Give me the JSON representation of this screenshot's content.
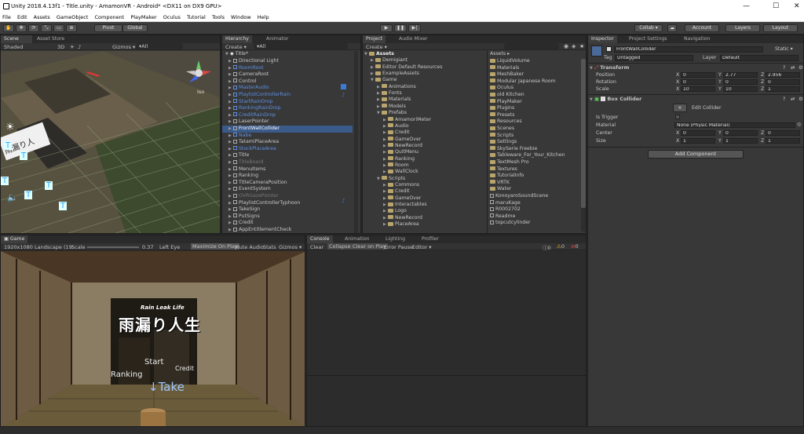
{
  "window": {
    "title": "Unity 2018.4.13f1 - Title.unity - AmamonVR - Android* <DX11 on DX9 GPU>"
  },
  "menu": [
    "File",
    "Edit",
    "Assets",
    "GameObject",
    "Component",
    "PlayMaker",
    "Oculus",
    "Tutorial",
    "Tools",
    "Window",
    "Help"
  ],
  "toolbar": {
    "pivot": "Pivot",
    "global": "Global",
    "collab": "Collab ▾",
    "account": "Account",
    "layers": "Layers",
    "layout": "Layout"
  },
  "scene": {
    "tabs": [
      "Scene",
      "Asset Store"
    ],
    "shading": "Shaded",
    "mode2d": "3D",
    "gizmos": "Gizmos ▾",
    "search": "▾All",
    "iso": "Iso"
  },
  "hierarchy": {
    "tabs": [
      "Hierarchy",
      "Animator"
    ],
    "create": "Create ▾",
    "search": "▾All",
    "scene_name": "Title*",
    "items": [
      {
        "label": "Directional Light",
        "style": "normal"
      },
      {
        "label": "RoomRoot",
        "style": "blue"
      },
      {
        "label": "CameraRoot",
        "style": "normal"
      },
      {
        "label": "Control",
        "style": "normal"
      },
      {
        "label": "MasterAudio",
        "style": "blue"
      },
      {
        "label": "PlaylistControllerRain",
        "style": "blue"
      },
      {
        "label": "StartRainDrop",
        "style": "blue"
      },
      {
        "label": "RankingRainDrop",
        "style": "blue"
      },
      {
        "label": "CreditRainDrop",
        "style": "blue"
      },
      {
        "label": "LaserPointer",
        "style": "normal"
      },
      {
        "label": "FrontWallCollider",
        "style": "selected"
      },
      {
        "label": "Nabe",
        "style": "blue"
      },
      {
        "label": "TatamiPlaceArea",
        "style": "normal"
      },
      {
        "label": "StockPlaceArea",
        "style": "blue"
      },
      {
        "label": "Title",
        "style": "normal"
      },
      {
        "label": "TitleBoard",
        "style": "grayed"
      },
      {
        "label": "MenuItems",
        "style": "normal"
      },
      {
        "label": "Ranking",
        "style": "normal"
      },
      {
        "label": "TitleCameraPosition",
        "style": "normal"
      },
      {
        "label": "EventSystem",
        "style": "normal"
      },
      {
        "label": "OVRGazePointer",
        "style": "grayed"
      },
      {
        "label": "PlaylistControllerTyphoon",
        "style": "normal"
      },
      {
        "label": "TakeSign",
        "style": "normal"
      },
      {
        "label": "PutSigns",
        "style": "normal"
      },
      {
        "label": "Credit",
        "style": "normal"
      },
      {
        "label": "AppEntitlementCheck",
        "style": "normal"
      }
    ]
  },
  "project": {
    "tabs": [
      "Project",
      "Audio Mixer"
    ],
    "create": "Create ▾",
    "tree": [
      {
        "label": "Assets",
        "indent": 0
      },
      {
        "label": "Demigiant",
        "indent": 1
      },
      {
        "label": "Editor Default Resources",
        "indent": 1
      },
      {
        "label": "ExampleAssets",
        "indent": 1
      },
      {
        "label": "Game",
        "indent": 1
      },
      {
        "label": "Animations",
        "indent": 2
      },
      {
        "label": "Fonts",
        "indent": 2
      },
      {
        "label": "Materials",
        "indent": 2
      },
      {
        "label": "Models",
        "indent": 2
      },
      {
        "label": "Prefabs",
        "indent": 2
      },
      {
        "label": "AmamoriMeter",
        "indent": 3
      },
      {
        "label": "Audio",
        "indent": 3
      },
      {
        "label": "Credit",
        "indent": 3
      },
      {
        "label": "GameOver",
        "indent": 3
      },
      {
        "label": "NewRecord",
        "indent": 3
      },
      {
        "label": "QuitMenu",
        "indent": 3
      },
      {
        "label": "Ranking",
        "indent": 3
      },
      {
        "label": "Room",
        "indent": 3
      },
      {
        "label": "WallClock",
        "indent": 3
      },
      {
        "label": "Scripts",
        "indent": 2
      },
      {
        "label": "Commons",
        "indent": 3
      },
      {
        "label": "Credit",
        "indent": 3
      },
      {
        "label": "GameOver",
        "indent": 3
      },
      {
        "label": "Interactables",
        "indent": 3
      },
      {
        "label": "Logo",
        "indent": 3
      },
      {
        "label": "NewRecord",
        "indent": 3
      },
      {
        "label": "PlaceArea",
        "indent": 3
      }
    ],
    "assets_header": "Assets ▸",
    "assets": [
      "LiquidVolume",
      "Materials",
      "MeshBaker",
      "Modular Japanese Room",
      "Oculus",
      "old Kitchen",
      "PlayMaker",
      "Plugins",
      "Presets",
      "Resources",
      "Scenes",
      "Scripts",
      "Settings",
      "SkySerie Freebie",
      "Tableware_For_Your_Kitchen",
      "TextMesh Pro",
      "Textures",
      "TutorialInfo",
      "VRTK",
      "Water",
      "KonoyaroSoundScene",
      "maruKage",
      "R0002702",
      "Readme",
      "topcutcylinder"
    ]
  },
  "inspector": {
    "tabs": [
      "Inspector",
      "Project Settings",
      "Navigation"
    ],
    "object_name": "FrontWallCollider",
    "static": "Static ▾",
    "tag_label": "Tag",
    "tag": "Untagged",
    "layer_label": "Layer",
    "layer": "Default",
    "transform": {
      "title": "Transform",
      "position_label": "Position",
      "position": {
        "x": "0",
        "y": "2.77",
        "z": "2.956"
      },
      "rotation_label": "Rotation",
      "rotation": {
        "x": "0",
        "y": "0",
        "z": "0"
      },
      "scale_label": "Scale",
      "scale": {
        "x": "10",
        "y": "10",
        "z": "1"
      }
    },
    "box_collider": {
      "title": "Box Collider",
      "edit_label": "Edit Collider",
      "is_trigger_label": "Is Trigger",
      "material_label": "Material",
      "material": "None (Physic Material)",
      "center_label": "Center",
      "center": {
        "x": "0",
        "y": "0",
        "z": "0"
      },
      "size_label": "Size",
      "size": {
        "x": "1",
        "y": "1",
        "z": "1"
      }
    },
    "add_component": "Add Component"
  },
  "game": {
    "tab": "Game",
    "resolution": "1920x1080 Landscape (19:",
    "scale_label": "Scale",
    "scale_value": "0.37",
    "eye": "Left Eye",
    "maximize": "Maximize On Play",
    "mute": "Mute Audio",
    "stats": "Stats",
    "gizmos": "Gizmos ▾",
    "logo_small": "Rain Leak Life",
    "logo_big": "雨漏り人生",
    "menu_start": "Start",
    "menu_credit": "Credit",
    "menu_ranking": "Ranking",
    "menu_take": "↓Take"
  },
  "console": {
    "tabs": [
      "Console",
      "Animation",
      "Lighting",
      "Profiler"
    ],
    "buttons": [
      "Clear",
      "Collapse",
      "Clear on Play",
      "Error Pause",
      "Editor ▾"
    ],
    "counts": [
      "0",
      "0",
      "0"
    ]
  }
}
